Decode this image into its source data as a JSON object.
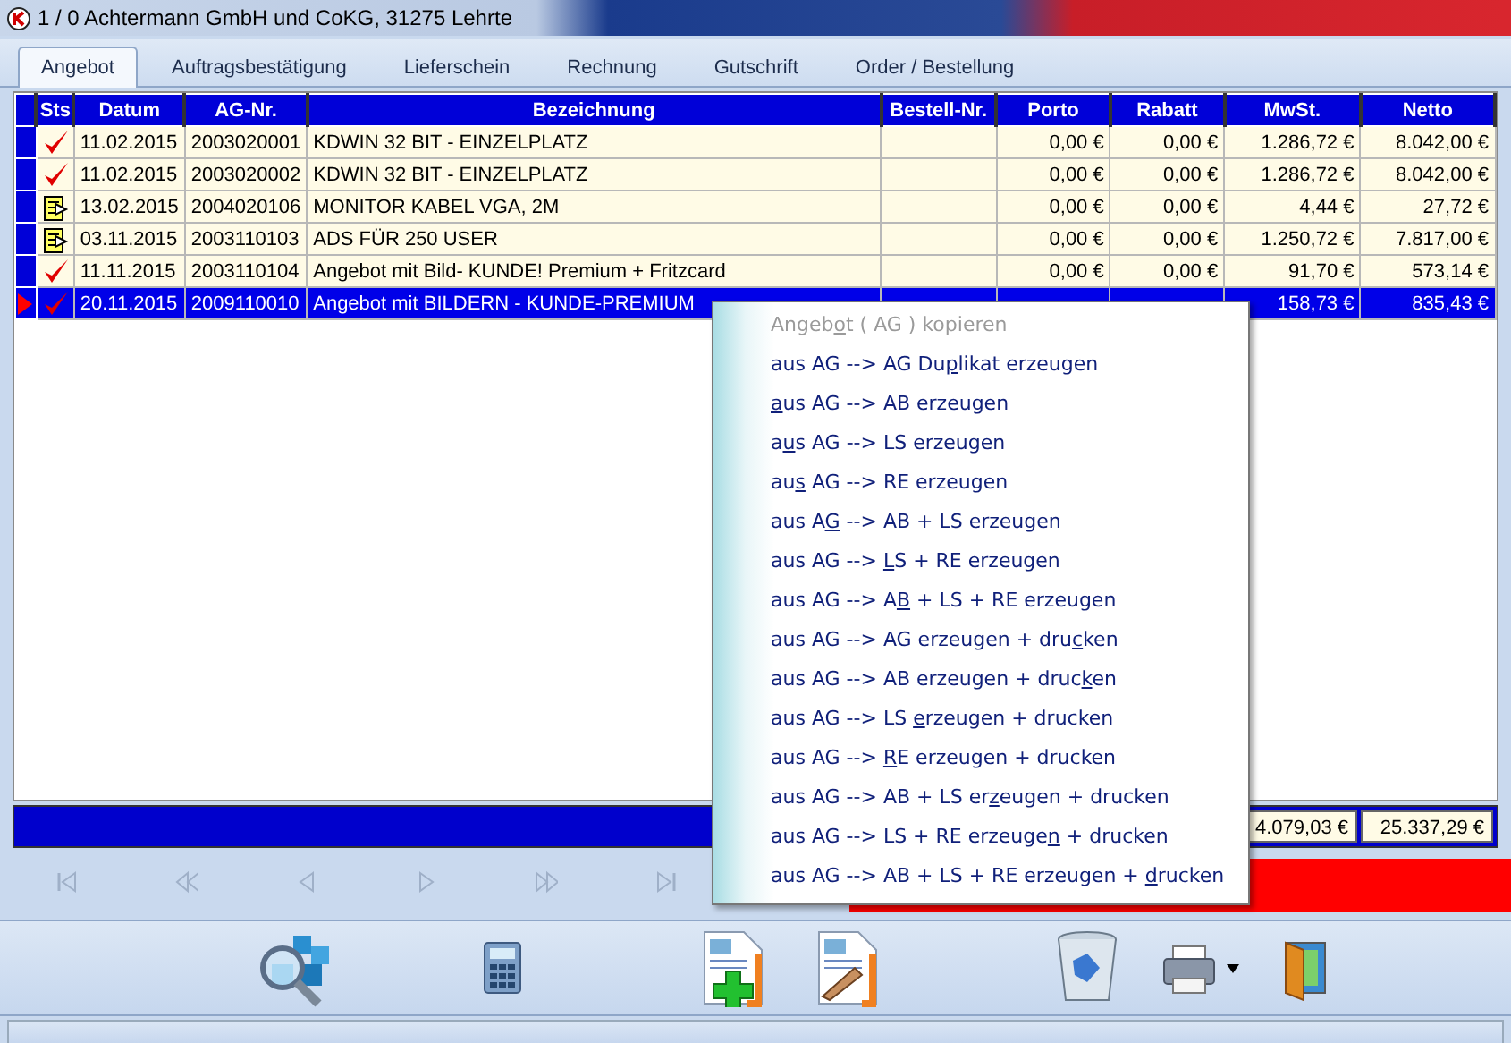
{
  "window": {
    "title": "1 / 0 Achtermann GmbH und CoKG, 31275 Lehrte"
  },
  "tabs": [
    {
      "label": "Angebot",
      "selected": true
    },
    {
      "label": "Auftragsbestätigung",
      "selected": false
    },
    {
      "label": "Lieferschein",
      "selected": false
    },
    {
      "label": "Rechnung",
      "selected": false
    },
    {
      "label": "Gutschrift",
      "selected": false
    },
    {
      "label": "Order / Bestellung",
      "selected": false
    }
  ],
  "table": {
    "columns": [
      "Sts",
      "Datum",
      "AG-Nr.",
      "Bezeichnung",
      "Bestell-Nr.",
      "Porto",
      "Rabatt",
      "MwSt.",
      "Netto"
    ],
    "rows": [
      {
        "kind": "check",
        "date": "11.02.2015",
        "number": "2003020001",
        "description": "KDWIN 32 BIT - EINZELPLATZ",
        "porto": "0,00 €",
        "rabatt": "0,00 €",
        "mwst": "1.286,72 €",
        "netto": "8.042,00 €",
        "selected": false
      },
      {
        "kind": "check",
        "date": "11.02.2015",
        "number": "2003020002",
        "description": "KDWIN 32 BIT - EINZELPLATZ",
        "porto": "0,00 €",
        "rabatt": "0,00 €",
        "mwst": "1.286,72 €",
        "netto": "8.042,00 €",
        "selected": false
      },
      {
        "kind": "document",
        "date": "13.02.2015",
        "number": "2004020106",
        "description": "MONITOR KABEL VGA, 2M",
        "porto": "0,00 €",
        "rabatt": "0,00 €",
        "mwst": "4,44 €",
        "netto": "27,72 €",
        "selected": false
      },
      {
        "kind": "document",
        "date": "03.11.2015",
        "number": "2003110103",
        "description": "ADS FÜR 250 USER",
        "porto": "0,00 €",
        "rabatt": "0,00 €",
        "mwst": "1.250,72 €",
        "netto": "7.817,00 €",
        "selected": false
      },
      {
        "kind": "check",
        "date": "11.11.2015",
        "number": "2003110104",
        "description": "Angebot mit Bild- KUNDE! Premium + Fritzcard",
        "porto": "0,00 €",
        "rabatt": "0,00 €",
        "mwst": "91,70 €",
        "netto": "573,14 €",
        "selected": false
      },
      {
        "kind": "check",
        "date": "20.11.2015",
        "number": "2009110010",
        "description": "Angebot mit BILDERN - KUNDE-PREMIUM",
        "mwst": "158,73 €",
        "netto": "835,43 €",
        "selected": true
      }
    ],
    "totals": {
      "mwst": "4.079,03 €",
      "netto": "25.337,29 €"
    }
  },
  "context_menu": {
    "items": [
      {
        "before": "Angeb",
        "key": "o",
        "after": "t ( AG ) kopieren",
        "disabled": true
      },
      {
        "before": "aus AG --> AG Du",
        "key": "p",
        "after": "likat erzeugen",
        "disabled": false
      },
      {
        "key": "a",
        "after": "us AG --> AB erzeugen",
        "disabled": false
      },
      {
        "before": "a",
        "key": "u",
        "after": "s AG --> LS erzeugen",
        "disabled": false
      },
      {
        "before": "au",
        "key": "s",
        "after": " AG --> RE erzeugen",
        "disabled": false
      },
      {
        "before": "aus A",
        "key": "G",
        "after": " --> AB + LS erzeugen",
        "disabled": false
      },
      {
        "before": "aus AG --> ",
        "key": "L",
        "after": "S + RE erzeugen",
        "disabled": false
      },
      {
        "before": "aus AG --> A",
        "key": "B",
        "after": " + LS + RE erzeugen",
        "disabled": false
      },
      {
        "before": "aus AG --> AG erzeugen + dru",
        "key": "c",
        "after": "ken",
        "disabled": false
      },
      {
        "before": "aus AG --> AB erzeugen + druc",
        "key": "k",
        "after": "en",
        "disabled": false
      },
      {
        "before": "aus AG --> LS ",
        "key": "e",
        "after": "rzeugen + drucken",
        "disabled": false
      },
      {
        "before": "aus AG --> ",
        "key": "R",
        "after": "E erzeugen + drucken",
        "disabled": false
      },
      {
        "before": "aus AG --> AB + LS er",
        "key": "z",
        "after": "eugen + drucken",
        "disabled": false
      },
      {
        "before": "aus AG --> LS + RE erzeuge",
        "key": "n",
        "after": " + drucken",
        "disabled": false
      },
      {
        "before": "aus AG --> AB + LS + RE erzeugen + ",
        "key": "d",
        "after": "rucken",
        "disabled": false
      }
    ]
  }
}
